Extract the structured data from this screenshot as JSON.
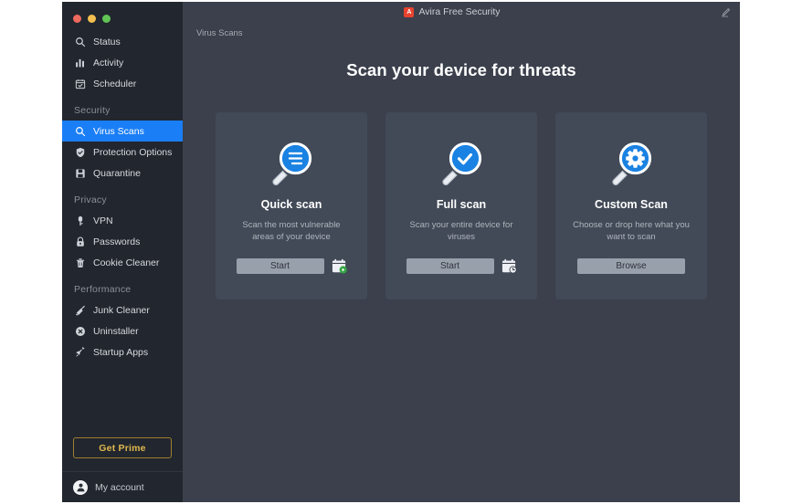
{
  "window": {
    "title": "Avira Free Security",
    "logo_icon": "avira-logo-icon",
    "logo_letter": "A",
    "compose_icon": "compose-icon",
    "traffic_lights": [
      "close",
      "minimize",
      "zoom"
    ]
  },
  "sidebar": {
    "groups": [
      {
        "label": "",
        "items": [
          {
            "label": "Status",
            "icon": "magnifier-icon",
            "active": false
          },
          {
            "label": "Activity",
            "icon": "bar-chart-icon",
            "active": false
          },
          {
            "label": "Scheduler",
            "icon": "calendar-check-icon",
            "active": false
          }
        ]
      },
      {
        "label": "Security",
        "items": [
          {
            "label": "Virus Scans",
            "icon": "magnifier-icon",
            "active": true
          },
          {
            "label": "Protection Options",
            "icon": "shield-icon",
            "active": false
          },
          {
            "label": "Quarantine",
            "icon": "save-box-icon",
            "active": false
          }
        ]
      },
      {
        "label": "Privacy",
        "items": [
          {
            "label": "VPN",
            "icon": "vpn-key-icon",
            "active": false
          },
          {
            "label": "Passwords",
            "icon": "padlock-icon",
            "active": false
          },
          {
            "label": "Cookie Cleaner",
            "icon": "trash-icon",
            "active": false
          }
        ]
      },
      {
        "label": "Performance",
        "items": [
          {
            "label": "Junk Cleaner",
            "icon": "broom-icon",
            "active": false
          },
          {
            "label": "Uninstaller",
            "icon": "circle-x-icon",
            "active": false
          },
          {
            "label": "Startup Apps",
            "icon": "rocket-icon",
            "active": false
          }
        ]
      }
    ],
    "get_prime_label": "Get Prime",
    "account_label": "My account",
    "account_icon": "user-avatar-icon"
  },
  "main": {
    "breadcrumb": "Virus Scans",
    "heading": "Scan your device for threats",
    "cards": [
      {
        "title": "Quick scan",
        "description": "Scan the most vulnerable areas of your device",
        "button_label": "Start",
        "icon": "magnifier-lines-icon",
        "schedule_icon": "calendar-play-icon",
        "has_schedule": true
      },
      {
        "title": "Full scan",
        "description": "Scan your entire device for viruses",
        "button_label": "Start",
        "icon": "magnifier-check-icon",
        "schedule_icon": "calendar-clock-icon",
        "has_schedule": true
      },
      {
        "title": "Custom Scan",
        "description": "Choose or drop here what you want to scan",
        "button_label": "Browse",
        "icon": "magnifier-gear-icon",
        "schedule_icon": "",
        "has_schedule": false
      }
    ]
  },
  "colors": {
    "sidebar_bg": "#22262e",
    "main_bg": "#3b404c",
    "card_bg": "#424a57",
    "accent_blue": "#1a7ef6",
    "icon_blue": "#1a82e2",
    "prime_gold": "#e0b94e",
    "button_gray": "#98a0ab",
    "logo_red": "#e8432f",
    "badge_green": "#3aa33a"
  }
}
